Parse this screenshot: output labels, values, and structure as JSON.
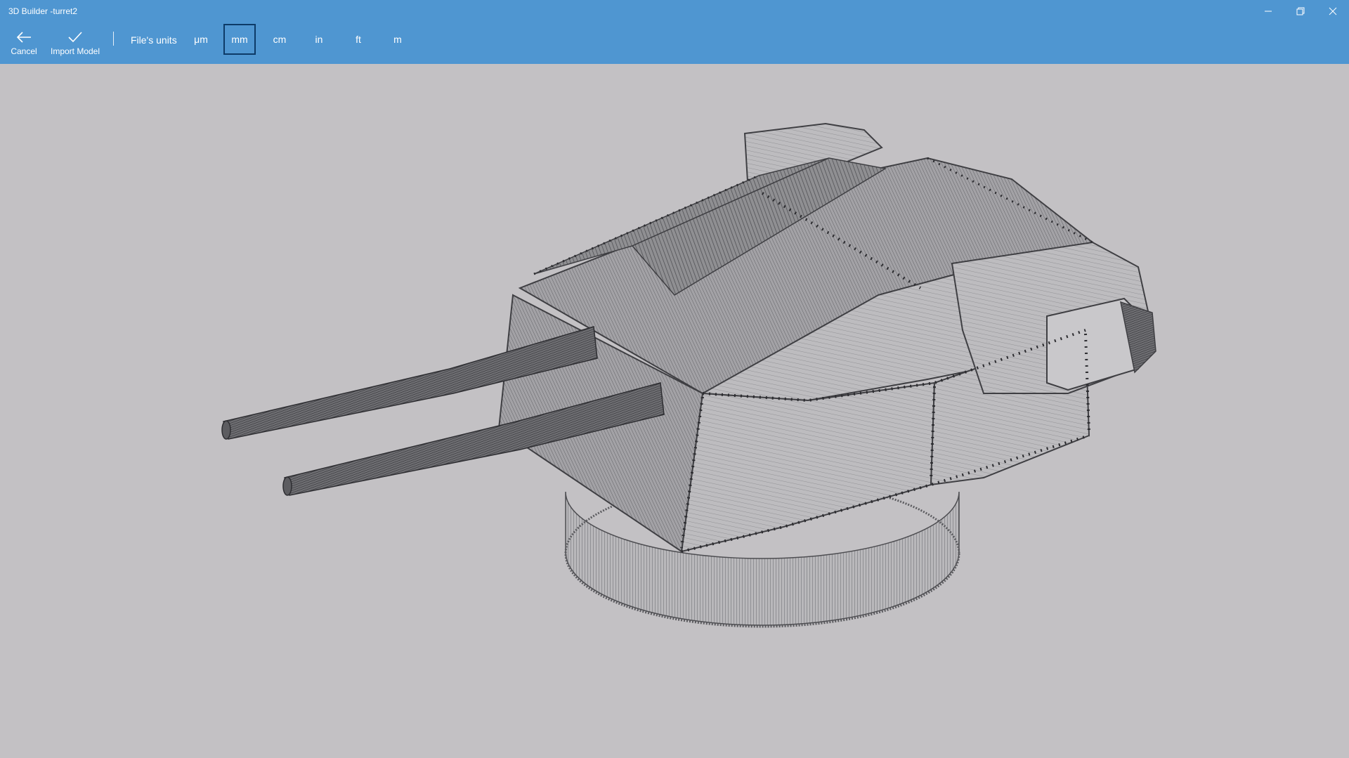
{
  "window": {
    "title": "3D Builder -turret2",
    "minimize_icon": "minimize-icon",
    "restore_icon": "restore-icon",
    "close_icon": "close-icon"
  },
  "toolbar": {
    "cancel_label": "Cancel",
    "cancel_icon": "back-arrow-icon",
    "import_label": "Import Model",
    "import_icon": "checkmark-icon",
    "units_label": "File's units",
    "units": [
      "μm",
      "mm",
      "cm",
      "in",
      "ft",
      "m"
    ],
    "selected_unit": "mm"
  },
  "viewport": {
    "model": "turret2",
    "background_color": "#c3c1c4"
  },
  "colors": {
    "accent": "#4f96d1",
    "selected_border": "#0d3a67",
    "text": "#ffffff"
  }
}
